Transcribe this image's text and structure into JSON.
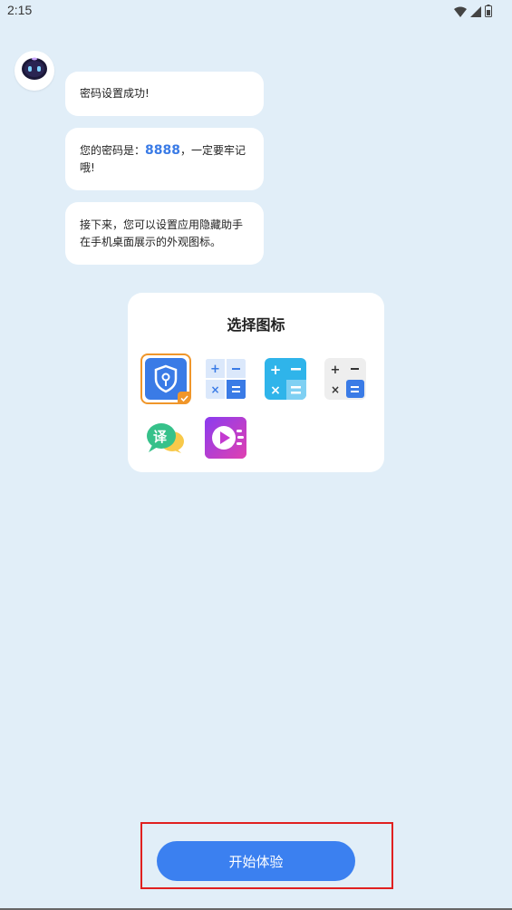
{
  "status_bar": {
    "time": "2:15",
    "icons": [
      "wifi-icon",
      "signal-icon",
      "battery-icon"
    ]
  },
  "chat": {
    "avatar": "robot-icon",
    "messages": [
      {
        "text": "密码设置成功!"
      },
      {
        "prefix": "您的密码是：",
        "password": "8888",
        "suffix": "，一定要牢记哦!"
      },
      {
        "text": "接下来，您可以设置应用隐藏助手在手机桌面展示的外观图标。"
      }
    ]
  },
  "icon_picker": {
    "title": "选择图标",
    "selected_index": 0,
    "icons": [
      {
        "name": "shield-lock-icon",
        "selected": true
      },
      {
        "name": "calculator-light-icon",
        "selected": false
      },
      {
        "name": "calculator-blue-icon",
        "selected": false
      },
      {
        "name": "calculator-gray-icon",
        "selected": false
      },
      {
        "name": "translate-icon",
        "label": "译",
        "selected": false
      },
      {
        "name": "video-player-icon",
        "selected": false
      }
    ]
  },
  "footer": {
    "start_button_label": "开始体验"
  },
  "colors": {
    "background": "#e1eef8",
    "accent": "#3b80f0",
    "selected_border": "#f0962a",
    "highlight": "#e02020"
  }
}
